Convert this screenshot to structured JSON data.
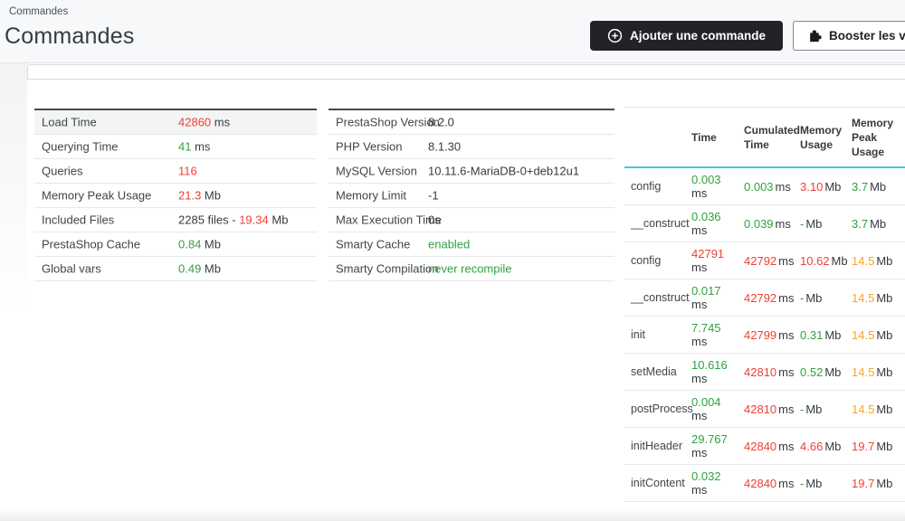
{
  "header": {
    "breadcrumb": "Commandes",
    "title": "Commandes",
    "add_button": "Ajouter une commande",
    "boost_button": "Booster les ventes"
  },
  "colors": {
    "red": "#ef4036",
    "green": "#30a13e",
    "orange": "#f7a42a",
    "teal": "#45c5de",
    "button_dark": "#222326"
  },
  "perf": {
    "rows": [
      {
        "label": "Load Time",
        "pre": "",
        "val": "42860",
        "val_class": "c-r",
        "suf": " ms"
      },
      {
        "label": "Querying Time",
        "pre": "",
        "val": "41",
        "val_class": "c-g",
        "suf": " ms"
      },
      {
        "label": "Queries",
        "pre": "",
        "val": "116",
        "val_class": "c-r",
        "suf": ""
      },
      {
        "label": "Memory Peak Usage",
        "pre": "",
        "val": "21.3",
        "val_class": "c-r",
        "suf": " Mb"
      },
      {
        "label": "Included Files",
        "pre": "2285 files - ",
        "val": "19.34",
        "val_class": "c-r",
        "suf": " Mb"
      },
      {
        "label": "PrestaShop Cache",
        "pre": "",
        "val": "0.84",
        "val_class": "c-g",
        "suf": " Mb"
      },
      {
        "label": "Global vars",
        "pre": "",
        "val": "0.49",
        "val_class": "c-g",
        "suf": " Mb"
      }
    ]
  },
  "env": {
    "rows": [
      {
        "label": "PrestaShop Version",
        "pre": "8.2.0",
        "val": "",
        "val_class": "c-d",
        "suf": ""
      },
      {
        "label": "PHP Version",
        "pre": "8.1.30",
        "val": "",
        "val_class": "c-d",
        "suf": ""
      },
      {
        "label": "MySQL Version",
        "pre": "10.11.6-MariaDB-0+deb12u1",
        "val": "",
        "val_class": "c-d",
        "suf": ""
      },
      {
        "label": "Memory Limit",
        "pre": "-1",
        "val": "",
        "val_class": "c-d",
        "suf": ""
      },
      {
        "label": "Max Execution Time",
        "pre": "0s",
        "val": "",
        "val_class": "c-d",
        "suf": ""
      },
      {
        "label": "Smarty Cache",
        "pre": "",
        "val": "enabled",
        "val_class": "c-g",
        "suf": ""
      },
      {
        "label": "Smarty Compilation",
        "pre": "",
        "val": "never recompile",
        "val_class": "c-g",
        "suf": ""
      }
    ]
  },
  "profile": {
    "headers": {
      "name": "",
      "time": "Time",
      "cumulated": "Cumulated Time",
      "memory": "Memory Usage",
      "peak": "Memory Peak Usage"
    },
    "rows": [
      {
        "name": "config",
        "time": "0.003",
        "time_class": "c-g",
        "time_unit": "ms",
        "cum": "0.003",
        "cum_class": "c-g",
        "cum_unit": "ms",
        "mem": "3.10",
        "mem_class": "c-r",
        "mem_unit": "Mb",
        "peak": "3.7",
        "peak_class": "c-g",
        "peak_unit": "Mb"
      },
      {
        "name": "__construct",
        "time": "0.036",
        "time_class": "c-g",
        "time_unit": "ms",
        "cum": "0.039",
        "cum_class": "c-g",
        "cum_unit": "ms",
        "mem": "-",
        "mem_class": "c-g",
        "mem_unit": "Mb",
        "peak": "3.7",
        "peak_class": "c-g",
        "peak_unit": "Mb"
      },
      {
        "name": "config",
        "time": "42791",
        "time_class": "c-r",
        "time_unit": "ms",
        "cum": "42792",
        "cum_class": "c-r",
        "cum_unit": "ms",
        "mem": "10.62",
        "mem_class": "c-r",
        "mem_unit": "Mb",
        "peak": "14.5",
        "peak_class": "c-o",
        "peak_unit": "Mb"
      },
      {
        "name": "__construct",
        "time": "0.017",
        "time_class": "c-g",
        "time_unit": "ms",
        "cum": "42792",
        "cum_class": "c-r",
        "cum_unit": "ms",
        "mem": "-",
        "mem_class": "c-g",
        "mem_unit": "Mb",
        "peak": "14.5",
        "peak_class": "c-o",
        "peak_unit": "Mb"
      },
      {
        "name": "init",
        "time": "7.745",
        "time_class": "c-g",
        "time_unit": "ms",
        "cum": "42799",
        "cum_class": "c-r",
        "cum_unit": "ms",
        "mem": "0.31",
        "mem_class": "c-g",
        "mem_unit": "Mb",
        "peak": "14.5",
        "peak_class": "c-o",
        "peak_unit": "Mb"
      },
      {
        "name": "setMedia",
        "time": "10.616",
        "time_class": "c-g",
        "time_unit": "ms",
        "cum": "42810",
        "cum_class": "c-r",
        "cum_unit": "ms",
        "mem": "0.52",
        "mem_class": "c-g",
        "mem_unit": "Mb",
        "peak": "14.5",
        "peak_class": "c-o",
        "peak_unit": "Mb"
      },
      {
        "name": "postProcess",
        "time": "0.004",
        "time_class": "c-g",
        "time_unit": "ms",
        "cum": "42810",
        "cum_class": "c-r",
        "cum_unit": "ms",
        "mem": "-",
        "mem_class": "c-g",
        "mem_unit": "Mb",
        "peak": "14.5",
        "peak_class": "c-o",
        "peak_unit": "Mb"
      },
      {
        "name": "initHeader",
        "time": "29.767",
        "time_class": "c-g",
        "time_unit": "ms",
        "cum": "42840",
        "cum_class": "c-r",
        "cum_unit": "ms",
        "mem": "4.66",
        "mem_class": "c-r",
        "mem_unit": "Mb",
        "peak": "19.7",
        "peak_class": "c-r",
        "peak_unit": "Mb"
      },
      {
        "name": "initContent",
        "time": "0.032",
        "time_class": "c-g",
        "time_unit": "ms",
        "cum": "42840",
        "cum_class": "c-r",
        "cum_unit": "ms",
        "mem": "-",
        "mem_class": "c-g",
        "mem_unit": "Mb",
        "peak": "19.7",
        "peak_class": "c-r",
        "peak_unit": "Mb"
      }
    ]
  }
}
